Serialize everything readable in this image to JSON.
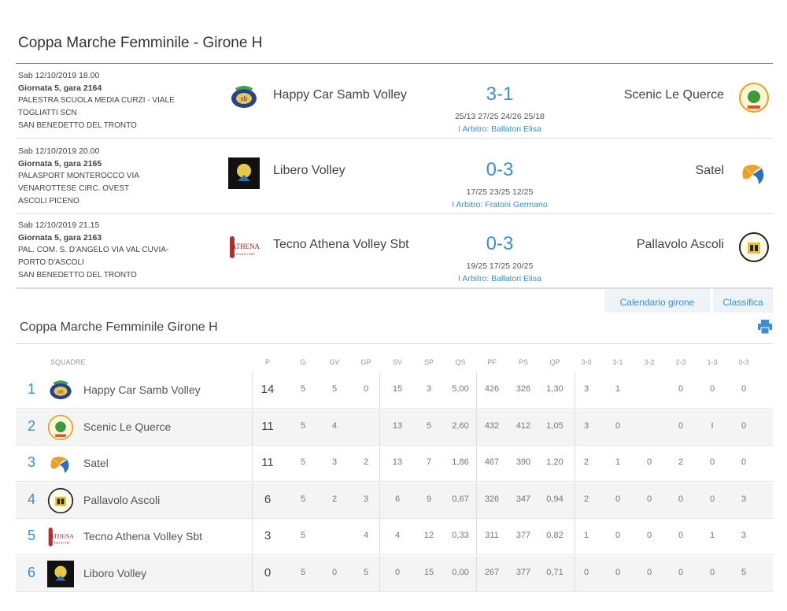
{
  "page_title": "Coppa Marche Femminile - Girone H",
  "colors": {
    "accent": "#3a8fd0",
    "row_alt": "#f4f4f4"
  },
  "matches": [
    {
      "datetime": "Sab 12/10/2019 18.00",
      "gara": "Giornata 5, gara 2164",
      "venue_1": "PALESTRA SCUOLA MEDIA CURZI - VIALE",
      "venue_2": "TOGLIATTI SCN",
      "venue_3": "SAN BENEDETTO DEL TRONTO",
      "home": "Happy Car Samb Volley",
      "home_logo": "happy-car-logo",
      "score": "3-1",
      "sets": "25/13 27/25 24/26 25/18",
      "referee": "I Arbitro: Ballatori Elisa",
      "away": "Scenic Le Querce",
      "away_logo": "scenic-le-querce-logo"
    },
    {
      "datetime": "Sab 12/10/2019 20.00",
      "gara": "Giornata 5, gara 2165",
      "venue_1": "PALASPORT MONTEROCCO VIA",
      "venue_2": "VENAROTTESE CIRC. OVEST",
      "venue_3": "ASCOLI PICENO",
      "home": "Libero Volley",
      "home_logo": "libero-volley-logo",
      "score": "0-3",
      "sets": "17/25 23/25 12/25",
      "referee": "I Arbitro: Fratoni Germano",
      "away": "Satel",
      "away_logo": "satel-logo"
    },
    {
      "datetime": "Sab 12/10/2019 21.15",
      "gara": "Giornata 5, gara 2163",
      "venue_1": "PAL. COM. S. D'ANGELO VIA VAL CUVIA-",
      "venue_2": "PORTO D'ASCOLI",
      "venue_3": "SAN BENEDETTO DEL TRONTO",
      "home": "Tecno Athena Volley Sbt",
      "home_logo": "tecno-athena-logo",
      "score": "0-3",
      "sets": "19/25 17/25 20/25",
      "referee": "I Arbitro: Ballatori Elisa",
      "away": "Pallavolo Ascoli",
      "away_logo": "pallavolo-ascoli-logo"
    }
  ],
  "tabs": {
    "calendar": "Calendario girone",
    "standings": "Classifica"
  },
  "standings_title": "Coppa Marche Femminile   Girone H",
  "columns": [
    "SQUADRE",
    "P",
    "G",
    "GV",
    "GP",
    "SV",
    "SP",
    "QS",
    "PF",
    "PS",
    "QP",
    "3-0",
    "3-1",
    "3-2",
    "2-3",
    "1-3",
    "0-3"
  ],
  "standings": [
    {
      "rank": "1",
      "team": "Happy Car Samb Volley",
      "logo": "happy-car-logo",
      "p": "14",
      "stats": [
        "5",
        "5",
        "0",
        "15",
        "3",
        "5,00",
        "426",
        "326",
        "1,30",
        "3",
        "1",
        "",
        "0",
        "0",
        "0"
      ]
    },
    {
      "rank": "2",
      "team": "Scenic Le Querce",
      "logo": "scenic-le-querce-logo",
      "p": "11",
      "stats": [
        "5",
        "4",
        "",
        "13",
        "5",
        "2,60",
        "432",
        "412",
        "1,05",
        "3",
        "0",
        "",
        "0",
        "I",
        "0"
      ]
    },
    {
      "rank": "3",
      "team": "Satel",
      "logo": "satel-logo",
      "p": "11",
      "stats": [
        "5",
        "3",
        "2",
        "13",
        "7",
        "1,86",
        "467",
        "390",
        "1,20",
        "2",
        "1",
        "0",
        "2",
        "0",
        "0"
      ]
    },
    {
      "rank": "4",
      "team": "Pallavolo Ascoli",
      "logo": "pallavolo-ascoli-logo",
      "p": "6",
      "stats": [
        "5",
        "2",
        "3",
        "6",
        "9",
        "0,67",
        "326",
        "347",
        "0,94",
        "2",
        "0",
        "0",
        "0",
        "0",
        "3"
      ]
    },
    {
      "rank": "5",
      "team": "Tecno Athena Volley Sbt",
      "logo": "tecno-athena-logo",
      "p": "3",
      "stats": [
        "5",
        "",
        "4",
        "4",
        "12",
        "0,33",
        "311",
        "377",
        "0,82",
        "1",
        "0",
        "0",
        "0",
        "1",
        "3"
      ]
    },
    {
      "rank": "6",
      "team": "Liboro Volley",
      "logo": "libero-volley-logo",
      "p": "0",
      "stats": [
        "5",
        "0",
        "5",
        "0",
        "15",
        "0,00",
        "267",
        "377",
        "0,71",
        "0",
        "0",
        "0",
        "0",
        "0",
        "5"
      ]
    }
  ]
}
